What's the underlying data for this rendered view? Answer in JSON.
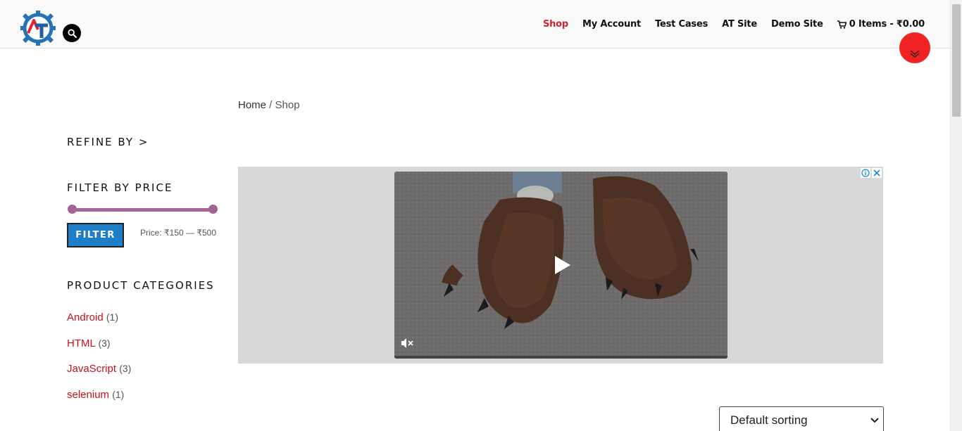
{
  "nav": {
    "items": [
      {
        "label": "Shop",
        "active": true
      },
      {
        "label": "My Account"
      },
      {
        "label": "Test Cases"
      },
      {
        "label": "AT Site"
      },
      {
        "label": "Demo Site"
      }
    ],
    "cart_label": "0 Items - ₹0.00"
  },
  "breadcrumb": {
    "home": "Home",
    "separator": " / ",
    "current": "Shop"
  },
  "sidebar": {
    "refine_heading": "REFINE BY >",
    "price_heading": "FILTER BY PRICE",
    "filter_button": "FILTER",
    "price_range_label": "Price: ₹150 — ₹500",
    "slider": {
      "min_fraction": 0.0,
      "max_fraction": 1.0
    },
    "categories_heading": "PRODUCT CATEGORIES",
    "categories": [
      {
        "name": "Android",
        "count": "(1)"
      },
      {
        "name": "HTML",
        "count": "(3)"
      },
      {
        "name": "JavaScript",
        "count": "(3)"
      },
      {
        "name": "selenium",
        "count": "(1)"
      }
    ]
  },
  "sort": {
    "selected": "Default sorting"
  },
  "colors": {
    "accent_red": "#d0232f",
    "scroll_top_red": "#ef2323",
    "slider_purple": "#a46497",
    "filter_blue": "#1e7ec8"
  },
  "icons": {
    "search": "search-icon",
    "cart": "cart-icon",
    "scroll_top": "chevron-up-icon",
    "play": "play-icon",
    "mute": "mute-icon",
    "ad_info": "info-icon",
    "ad_close": "close-icon"
  }
}
